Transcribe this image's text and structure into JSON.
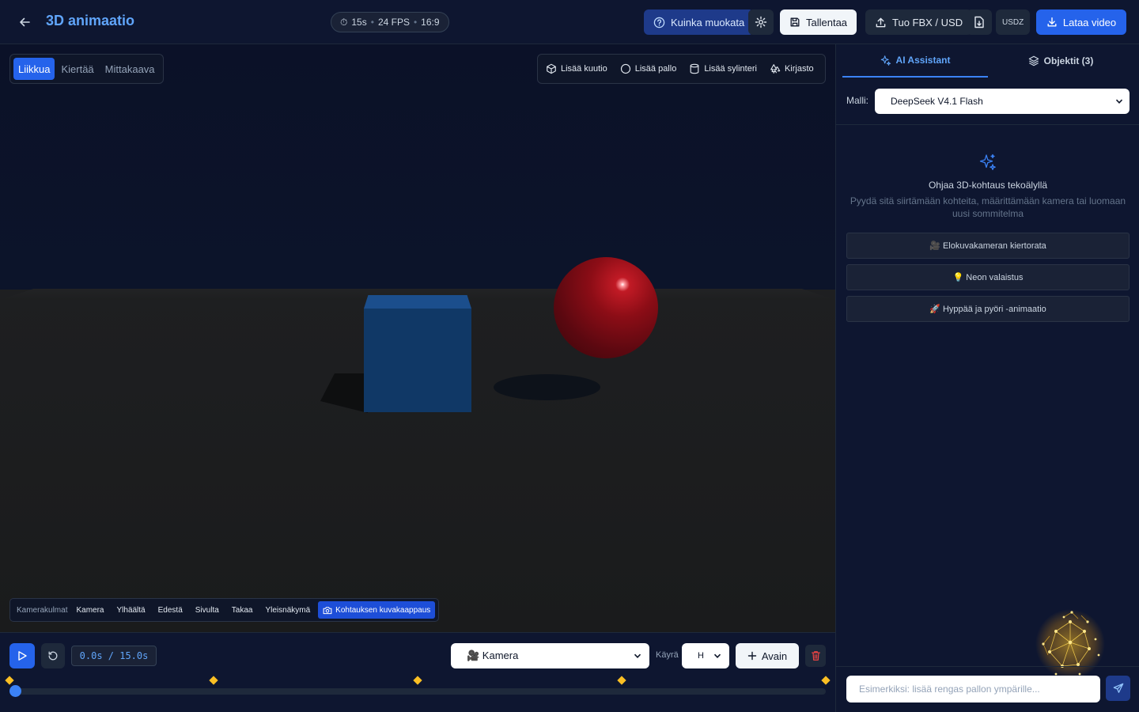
{
  "header": {
    "title": "3D animaatio",
    "pill": {
      "duration": "15s",
      "fps": "24 FPS",
      "aspect": "16:9",
      "sep": "•"
    },
    "help_label": "Kuinka muokata",
    "save_label": "Tallentaa",
    "import_label": "Tuo FBX / USD",
    "usdz_label": "USDZ",
    "download_label": "Lataa video"
  },
  "viewport": {
    "modes": [
      "Liikkua",
      "Kiertää",
      "Mittakaava"
    ],
    "active_mode": "Liikkua",
    "add_buttons": {
      "cube": "Lisää kuutio",
      "sphere": "Lisää pallo",
      "cylinder": "Lisää sylinteri",
      "library": "Kirjasto"
    },
    "camera_angles": {
      "label": "Kamerakulmat",
      "items": [
        "Kamera",
        "Ylhäältä",
        "Edestä",
        "Sivulta",
        "Takaa",
        "Yleisnäkymä"
      ],
      "snapshot_label": "Kohtauksen kuvakaappaus"
    },
    "colors": {
      "cube": "#103866",
      "sphere": "#8c0d16",
      "floor": "#1e1f21",
      "sky": "#0b1128"
    }
  },
  "timeline": {
    "time_display": "0.0s / 15.0s",
    "track_select": "🎥 Kamera",
    "curve_label": "Käyrä",
    "curve_value": "H",
    "add_key_label": "Avain",
    "keyframes_s": [
      0,
      3.75,
      7.5,
      11.25,
      15
    ],
    "playhead_s": 0,
    "duration_s": 15
  },
  "panel": {
    "tabs": {
      "ai": "AI Assistant",
      "objects": "Objektit (3)"
    },
    "model_label": "Malli:",
    "model_value": "DeepSeek V4.1 Flash",
    "empty_title": "Ohjaa 3D-kohtaus tekoälyllä",
    "empty_desc": "Pyydä sitä siirtämään kohteita, määrittämään kamera tai luomaan uusi sommitelma",
    "suggestions": [
      "🎥 Elokuvakameran kiertorata",
      "💡 Neon valaistus",
      "🚀 Hyppää ja pyöri -animaatio"
    ],
    "chat_placeholder": "Esimerkiksi: lisää rengas pallon ympärille..."
  }
}
